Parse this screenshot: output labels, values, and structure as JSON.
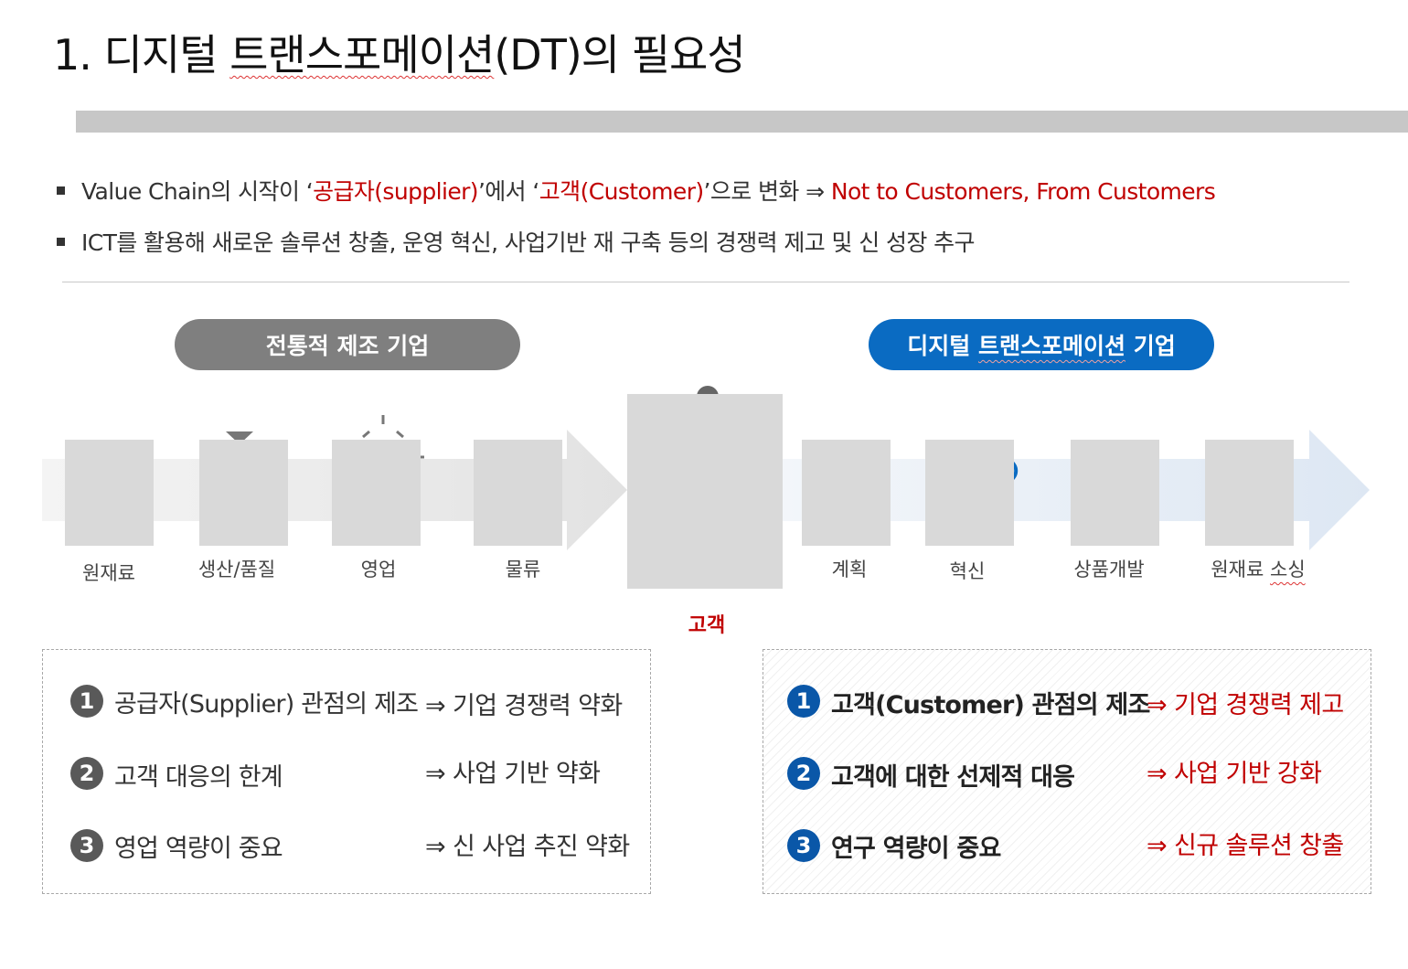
{
  "title": {
    "prefix": "1. 디지털 ",
    "underlined": "트랜스포메이션",
    "suffix": "(DT)의 필요성"
  },
  "bullets": [
    {
      "parts": [
        {
          "text": "Value Chain의 시작이 ‘",
          "color": "dark"
        },
        {
          "text": "공급자(supplier)",
          "color": "red"
        },
        {
          "text": "’에서 ‘",
          "color": "dark"
        },
        {
          "text": "고객(Customer)",
          "color": "red"
        },
        {
          "text": "’으로 변화 ⇒ ",
          "color": "dark"
        },
        {
          "text": "Not to Customers, From Customers",
          "color": "red"
        }
      ]
    },
    {
      "parts": [
        {
          "text": "ICT를 활용해 새로운 솔루션 창출, 운영 혁신, 사업기반 재 구축 등의 경쟁력 제고 및 신 성장 추구",
          "color": "dark"
        }
      ]
    }
  ],
  "pills": {
    "traditional": "전통적 제조 기업",
    "dt_prefix": "디지털 ",
    "dt_underlined": "트랜스포메이션",
    "dt_suffix": " 기업"
  },
  "chain": {
    "left_steps": [
      "원재료",
      "생산/품질",
      "영업",
      "물류"
    ],
    "customer": "고객",
    "right_steps": [
      "계획",
      "혁신",
      "상품개발"
    ],
    "last_step_prefix": "원재료 ",
    "last_step_underlined": "소싱"
  },
  "traditional_items": [
    {
      "num": "1",
      "text": "공급자(Supplier) 관점의 제조",
      "result": "⇒ 기업 경쟁력 약화"
    },
    {
      "num": "2",
      "text": "고객 대응의 한계",
      "result": "⇒ 사업 기반 약화"
    },
    {
      "num": "3",
      "text": "영업 역량이 중요",
      "result": "⇒ 신 사업 추진 약화"
    }
  ],
  "dt_items": [
    {
      "num": "1",
      "text": "고객(Customer) 관점의 제조",
      "result": "⇒ 기업 경쟁력 제고"
    },
    {
      "num": "2",
      "text": "고객에 대한 선제적 대응",
      "result": "⇒ 사업 기반 강화"
    },
    {
      "num": "3",
      "text": "연구 역량이 중요",
      "result": "⇒ 신규 솔루션 창출"
    }
  ],
  "colors": {
    "red": "#c00000",
    "dark": "#333333",
    "dt_blue": "#0a6bc2",
    "number_blue": "#0a57a8",
    "traditional_grey": "#7f7f7f"
  }
}
